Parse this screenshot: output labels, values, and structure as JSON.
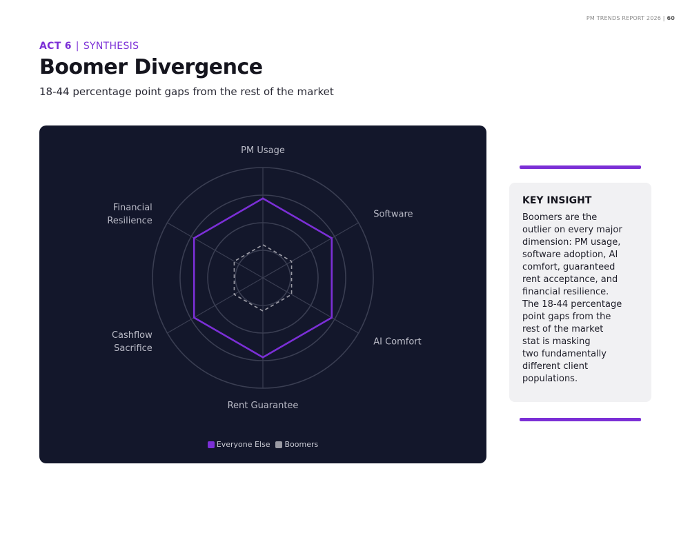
{
  "header": {
    "report": "PM TRENDS REPORT 2026 |",
    "page_number": "60"
  },
  "eyebrow": {
    "act": "ACT 6",
    "divider": "|",
    "section": "SYNTHESIS"
  },
  "title": "Boomer Divergence",
  "subtitle": "18-44 percentage point gaps from the rest of the market",
  "colors": {
    "accent": "#7b2fd6",
    "panel_bg": "#13172b",
    "boomers": "#9a9aa4",
    "grid": "#3a3e52"
  },
  "chart_data": {
    "type": "radar",
    "axes": [
      "PM Usage",
      "Software",
      "AI Comfort",
      "Rent Guarantee",
      "Cashflow Sacrifice",
      "Financial Resilience"
    ],
    "axis_label_lines": [
      [
        "PM Usage"
      ],
      [
        "Software"
      ],
      [
        "AI Comfort"
      ],
      [
        "Rent Guarantee"
      ],
      [
        "Cashflow",
        "Sacrifice"
      ],
      [
        "Financial",
        "Resilience"
      ]
    ],
    "range": [
      0,
      100
    ],
    "rings": 4,
    "grid": true,
    "legend_position": "bottom",
    "series": [
      {
        "name": "Everyone Else",
        "values": [
          72,
          72,
          72,
          72,
          72,
          72
        ],
        "color": "#7b2fd6",
        "style": "solid"
      },
      {
        "name": "Boomers",
        "values": [
          30,
          30,
          30,
          30,
          30,
          30
        ],
        "color": "#9a9aa4",
        "style": "dashed"
      }
    ]
  },
  "insight": {
    "title": "KEY INSIGHT",
    "body": "Boomers are the\noutlier on every major\ndimension: PM usage,\nsoftware adoption, AI\ncomfort, guaranteed\nrent acceptance, and\nfinancial resilience.\nThe 18-44 percentage\npoint gaps from the\nrest of the market\nstat is masking\ntwo fundamentally\ndifferent client\npopulations."
  }
}
